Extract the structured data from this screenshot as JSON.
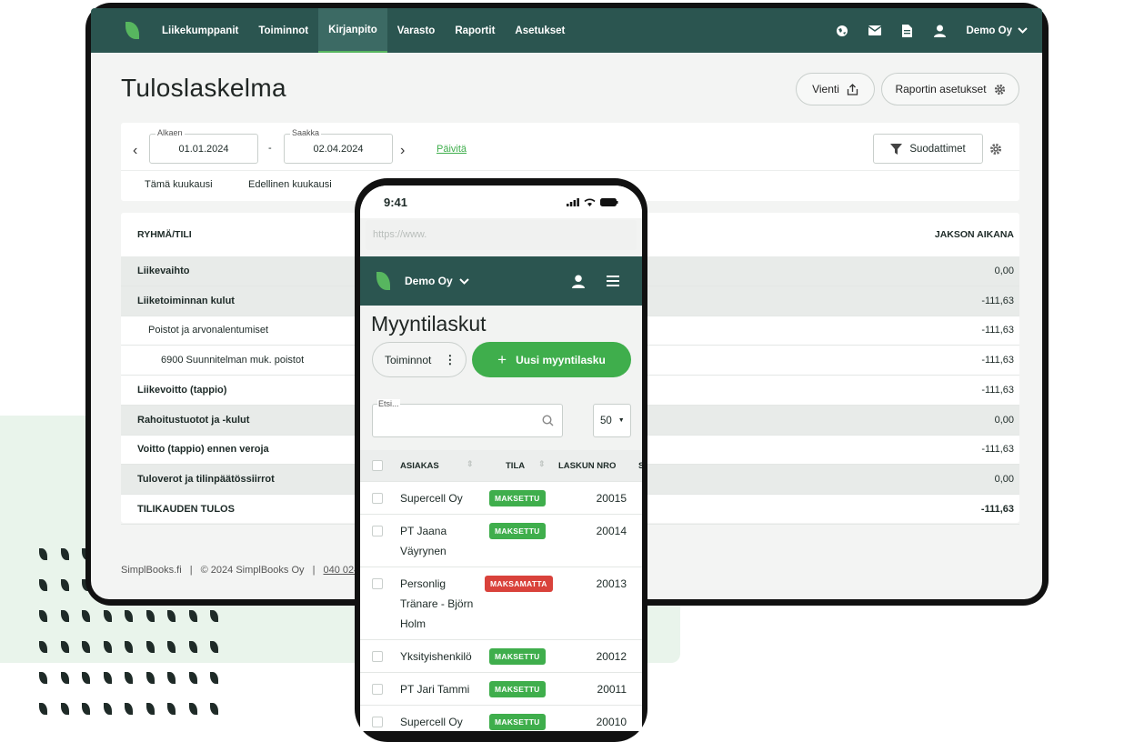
{
  "desktop": {
    "brand_color": "#2b5550",
    "accent_color": "#57b65f",
    "nav": {
      "items": [
        {
          "label": "Liikekumppanit"
        },
        {
          "label": "Toiminnot"
        },
        {
          "label": "Kirjanpito",
          "active": true
        },
        {
          "label": "Varasto"
        },
        {
          "label": "Raportit"
        },
        {
          "label": "Asetukset"
        }
      ],
      "company": "Demo Oy",
      "icons": [
        "globe-icon",
        "mail-icon",
        "document-icon",
        "user-icon",
        "chevron-down-icon"
      ]
    },
    "page_title": "Tuloslaskelma",
    "export_label": "Vienti",
    "report_settings_label": "Raportin asetukset",
    "filter": {
      "start_label": "Alkaen",
      "start_value": "01.01.2024",
      "separator": "-",
      "end_label": "Saakka",
      "end_value": "02.04.2024",
      "refresh_label": "Päivitä",
      "filters_label": "Suodattimet",
      "quick": [
        "Tämä kuukausi",
        "Edellinen kuukausi"
      ]
    },
    "table": {
      "col_group": "RYHMÄ/TILI",
      "col_period": "JAKSON AIKANA",
      "rows": [
        {
          "label": "Liikevaihto",
          "value": "0,00",
          "style": "grey",
          "indent": 0,
          "bold": true
        },
        {
          "label": "Liiketoiminnan kulut",
          "value": "-111,63",
          "style": "grey",
          "indent": 0,
          "bold": true
        },
        {
          "label": "Poistot ja arvonalentumiset",
          "value": "-111,63",
          "style": "white",
          "indent": 1,
          "bold": false
        },
        {
          "label": "6900 Suunnitelman muk. poistot",
          "value": "-111,63",
          "style": "white",
          "indent": 2,
          "bold": false
        },
        {
          "label": "Liikevoitto (tappio)",
          "value": "-111,63",
          "style": "white",
          "indent": 0,
          "bold": true
        },
        {
          "label": "Rahoitustuotot ja -kulut",
          "value": "0,00",
          "style": "grey",
          "indent": 0,
          "bold": true
        },
        {
          "label": "Voitto (tappio) ennen veroja",
          "value": "-111,63",
          "style": "white",
          "indent": 0,
          "bold": true
        },
        {
          "label": "Tuloverot ja tilinpäätössiirrot",
          "value": "0,00",
          "style": "grey",
          "indent": 0,
          "bold": true
        },
        {
          "label": "TILIKAUDEN TULOS",
          "value": "-111,63",
          "style": "white",
          "indent": 0,
          "bold": true
        }
      ]
    },
    "footer": {
      "site": "SimplBooks.fi",
      "copyright": "© 2024 SimplBooks Oy",
      "phone": "040 024 0"
    }
  },
  "mobile": {
    "time": "9:41",
    "url_placeholder": "https://www.",
    "company": "Demo Oy",
    "title": "Myyntilaskut",
    "actions_label": "Toiminnot",
    "new_invoice_label": "Uusi myyntilasku",
    "search_label": "Etsi...",
    "page_size": "50",
    "columns": {
      "customer": "ASIAKAS",
      "status": "TILA",
      "number": "LASKUN NRO",
      "extra": "S"
    },
    "rows": [
      {
        "customer": "Supercell Oy",
        "status": "MAKSETTU",
        "paid": true,
        "number": "20015"
      },
      {
        "customer": "PT Jaana Väyrynen",
        "status": "MAKSETTU",
        "paid": true,
        "number": "20014"
      },
      {
        "customer": "Personlig Tränare - Björn Holm",
        "status": "MAKSAMATTA",
        "paid": false,
        "number": "20013"
      },
      {
        "customer": "Yksityishenkilö",
        "status": "MAKSETTU",
        "paid": true,
        "number": "20012"
      },
      {
        "customer": "PT Jari Tammi",
        "status": "MAKSETTU",
        "paid": true,
        "number": "20011"
      },
      {
        "customer": "Supercell Oy",
        "status": "MAKSETTU",
        "paid": true,
        "number": "20010"
      }
    ]
  }
}
